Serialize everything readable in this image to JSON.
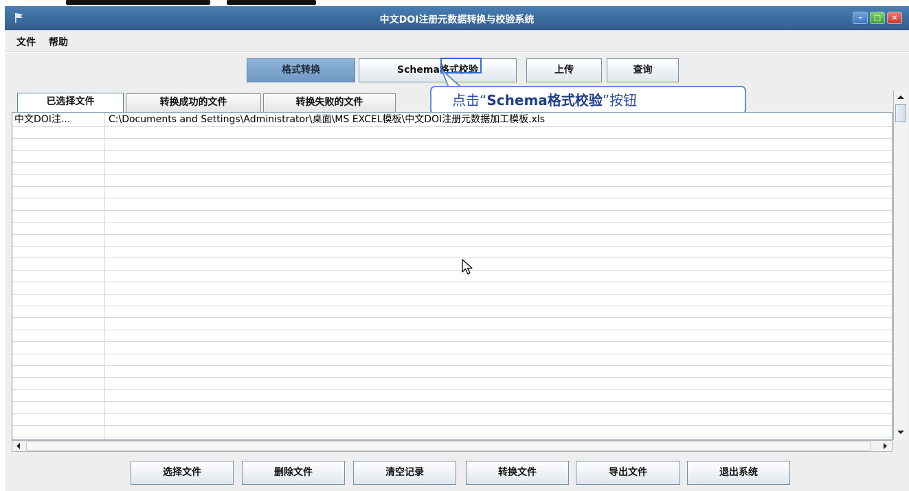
{
  "window": {
    "title": "中文DOI注册元数据转换与校验系统",
    "controls": {
      "minimize": "–",
      "maximize": "□",
      "close": "×"
    }
  },
  "menu": {
    "file": "文件",
    "help": "帮助"
  },
  "toolbar": {
    "format_convert": "格式转换",
    "schema_validate": "Schema格式校验",
    "upload": "上传",
    "query": "查询"
  },
  "callout": {
    "prefix": "点击",
    "open_quote": "“",
    "highlight": "Schema格式校验",
    "close_quote": "”",
    "suffix": "按钮"
  },
  "tabs": {
    "selected_files": "已选择文件",
    "success_files": "转换成功的文件",
    "failed_files": "转换失败的文件"
  },
  "table": {
    "rows": [
      {
        "name": "中文DOI注...",
        "path": "C:\\Documents and Settings\\Administrator\\桌面\\MS EXCEL模板\\中文DOI注册元数据加工模板.xls"
      }
    ]
  },
  "bottom_buttons": {
    "choose_file": "选择文件",
    "delete_file": "删除文件",
    "clear_records": "清空记录",
    "convert_file": "转换文件",
    "export_file": "导出文件",
    "exit_system": "退出系统"
  },
  "colors": {
    "titlebar": "#3c6d9f",
    "active_button": "#7fa6cd",
    "callout_border": "#5a8fd6",
    "callout_text": "#2b4ea3"
  },
  "icons": {
    "app": "flag-icon",
    "cursor": "mouse-pointer-icon"
  }
}
